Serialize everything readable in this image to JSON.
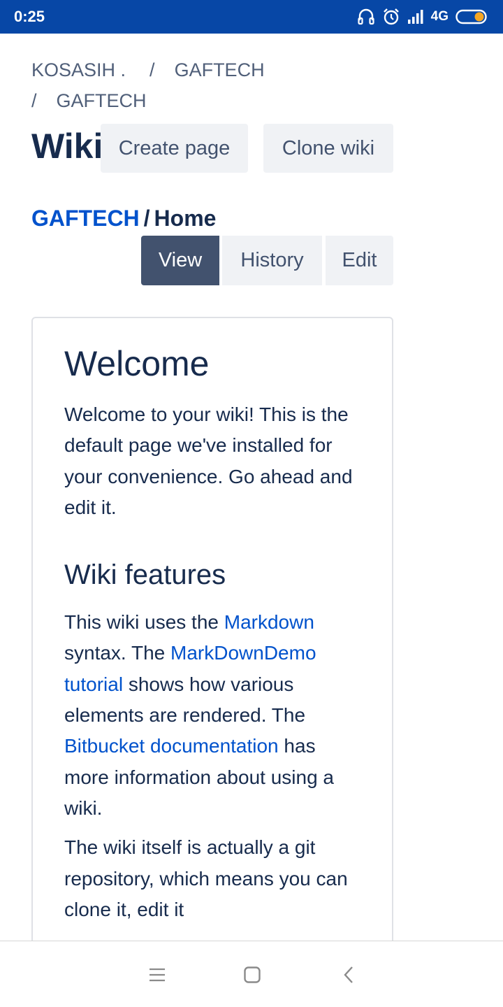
{
  "status_bar": {
    "time": "0:25",
    "network": "4G",
    "icons": [
      "headset-icon",
      "alarm-icon",
      "signal-icon",
      "battery-icon"
    ]
  },
  "breadcrumb": {
    "owner": "KOSASIH .",
    "project": "GAFTECH",
    "repo": "GAFTECH",
    "separator": "/"
  },
  "header": {
    "title": "Wiki",
    "create_page_label": "Create page",
    "clone_wiki_label": "Clone wiki"
  },
  "page_path": {
    "repo": "GAFTECH",
    "separator": "/",
    "page": "Home"
  },
  "tabs": [
    {
      "label": "View",
      "active": true
    },
    {
      "label": "History",
      "active": false
    },
    {
      "label": "Edit",
      "active": false
    }
  ],
  "article": {
    "heading": "Welcome",
    "intro": "Welcome to your wiki! This is the default page we've installed for your convenience. Go ahead and edit it.",
    "features_heading": "Wiki features",
    "features_p1": {
      "t1": "This wiki uses the ",
      "link1": "Markdown",
      "t2": " syntax. The ",
      "link2": "MarkDownDemo tutorial",
      "t3": " shows how various elements are rendered. The ",
      "link3": "Bitbucket documentation",
      "t4": " has more information about using a wiki."
    },
    "features_p2": "The wiki itself is actually a git repository, which means you can clone it, edit it"
  },
  "nav_bar": {
    "icons": [
      "menu-icon",
      "home-square-icon",
      "back-icon"
    ]
  },
  "colors": {
    "status_bar": "#0747a6",
    "link": "#0052cc",
    "text": "#172b4d",
    "active_tab": "#42526e",
    "button_bg": "#f0f2f5"
  }
}
